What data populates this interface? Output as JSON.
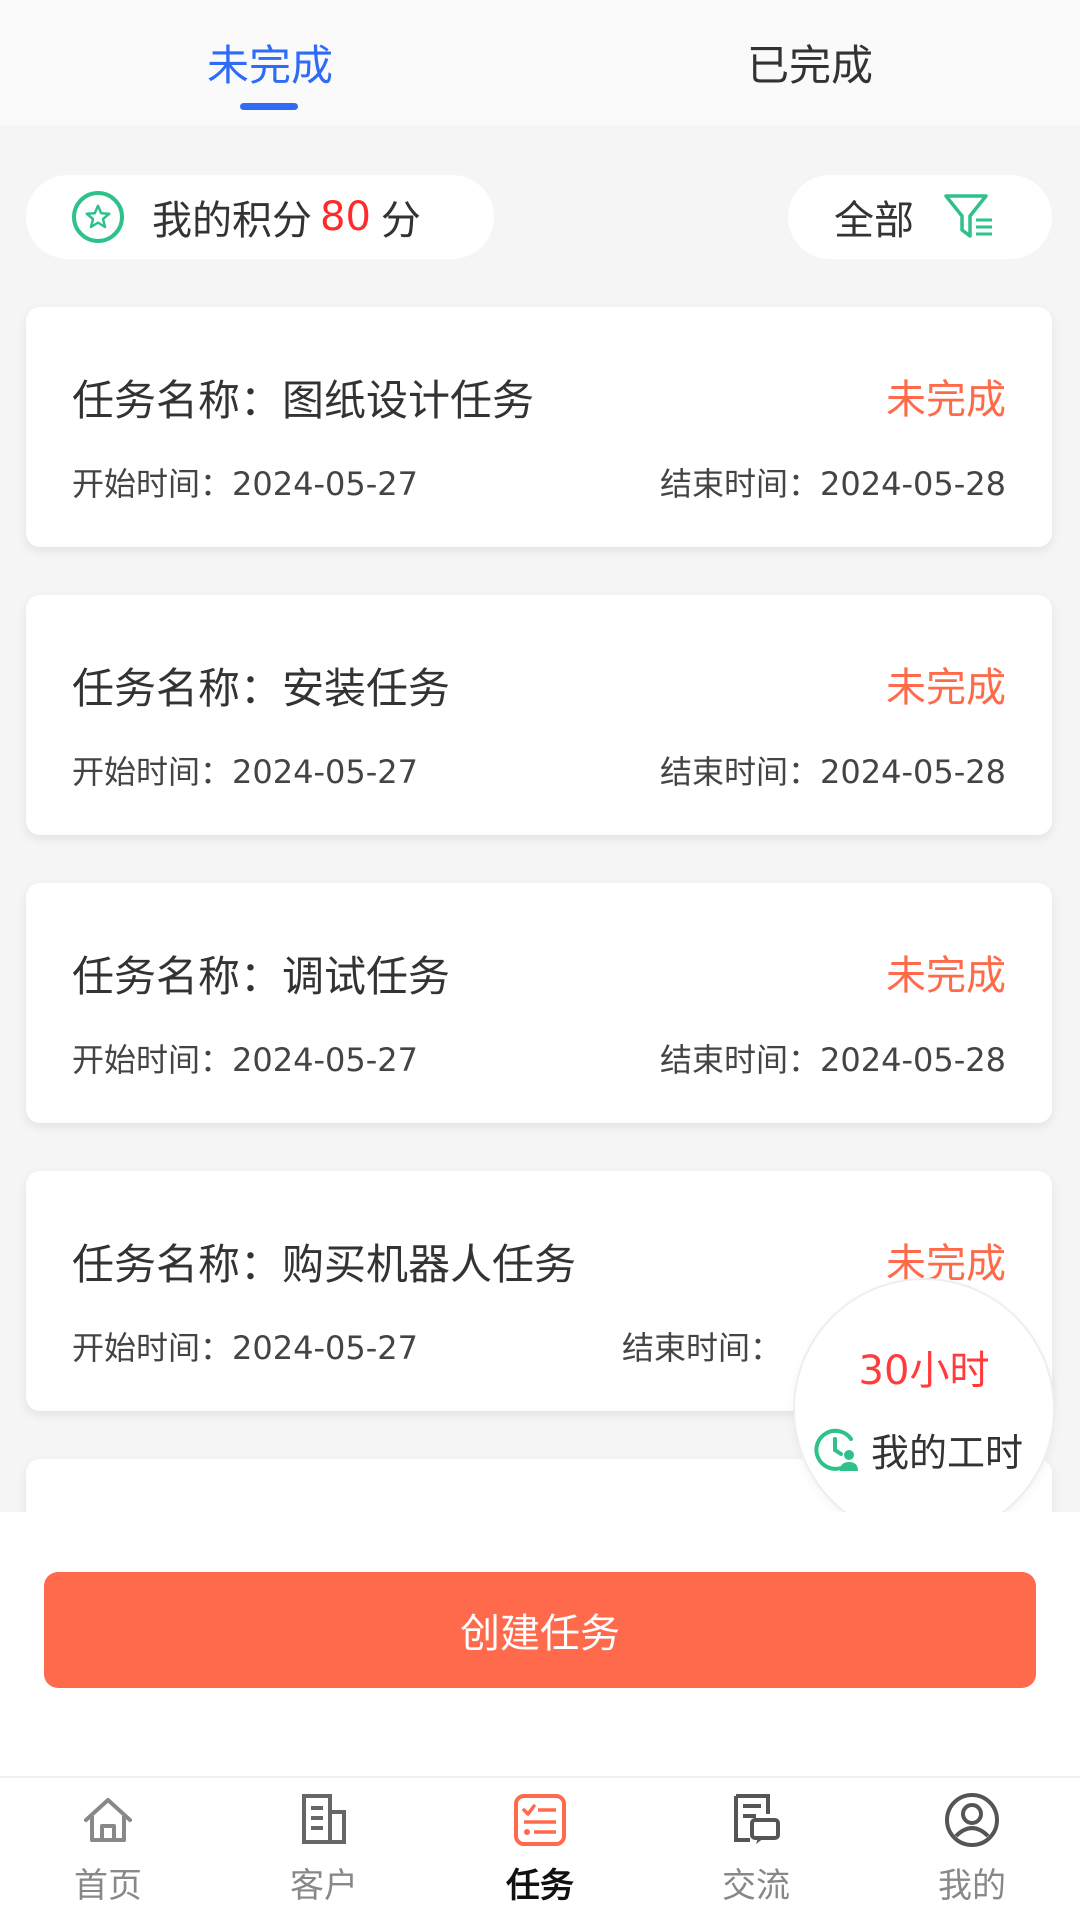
{
  "tabs": [
    {
      "label": "未完成",
      "active": true
    },
    {
      "label": "已完成",
      "active": false
    }
  ],
  "points": {
    "label": "我的积分",
    "value": "80",
    "unit": "分"
  },
  "filter": {
    "label": "全部"
  },
  "tasks": [
    {
      "name": "任务名称：图纸设计任务",
      "status": "未完成",
      "start": "开始时间：2024-05-27",
      "end": "结束时间：2024-05-28"
    },
    {
      "name": "任务名称：安装任务",
      "status": "未完成",
      "start": "开始时间：2024-05-27",
      "end": "结束时间：2024-05-28"
    },
    {
      "name": "任务名称：调试任务",
      "status": "未完成",
      "start": "开始时间：2024-05-27",
      "end": "结束时间：2024-05-28"
    },
    {
      "name": "任务名称：购买机器人任务",
      "status": "未完成",
      "start": "开始时间：2024-05-27",
      "end": "结束时间："
    }
  ],
  "work_hours": {
    "value": "30小时",
    "label": "我的工时"
  },
  "create_button": {
    "label": "创建任务"
  },
  "tabbar": [
    {
      "label": "首页",
      "icon": "home-icon",
      "active": false
    },
    {
      "label": "客户",
      "icon": "building-icon",
      "active": false
    },
    {
      "label": "任务",
      "icon": "task-list-icon",
      "active": true
    },
    {
      "label": "交流",
      "icon": "message-icon",
      "active": false
    },
    {
      "label": "我的",
      "icon": "user-icon",
      "active": false
    }
  ],
  "colors": {
    "accent_blue": "#2f6cf6",
    "status_red": "#ff6b4a",
    "button": "#ff6a4d",
    "icon_green": "#2ec28a"
  }
}
